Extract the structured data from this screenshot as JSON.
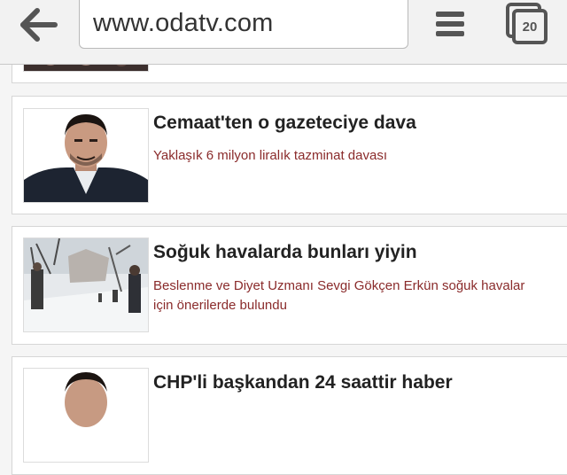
{
  "browser": {
    "url": "www.odatv.com",
    "tab_count": "20",
    "back_icon": "back-arrow-icon",
    "menu_icon": "hamburger-menu-icon",
    "tabs_icon": "tabs-icon"
  },
  "articles": [
    {
      "headline": "Cemaat'ten o gazeteciye dava",
      "summary": "Yaklaşık 6 milyon liralık tazminat davası"
    },
    {
      "headline": "Soğuk havalarda bunları yiyin",
      "summary": "Beslenme ve Diyet Uzmanı Sevgi Gökçen Erkün soğuk havalar için önerilerde bulundu"
    },
    {
      "headline": "CHP'li başkandan 24 saattir haber",
      "summary": ""
    }
  ],
  "colors": {
    "summary_text": "#8a2b2b",
    "headline_text": "#222222",
    "toolbar_bg": "#f2f2f2"
  }
}
